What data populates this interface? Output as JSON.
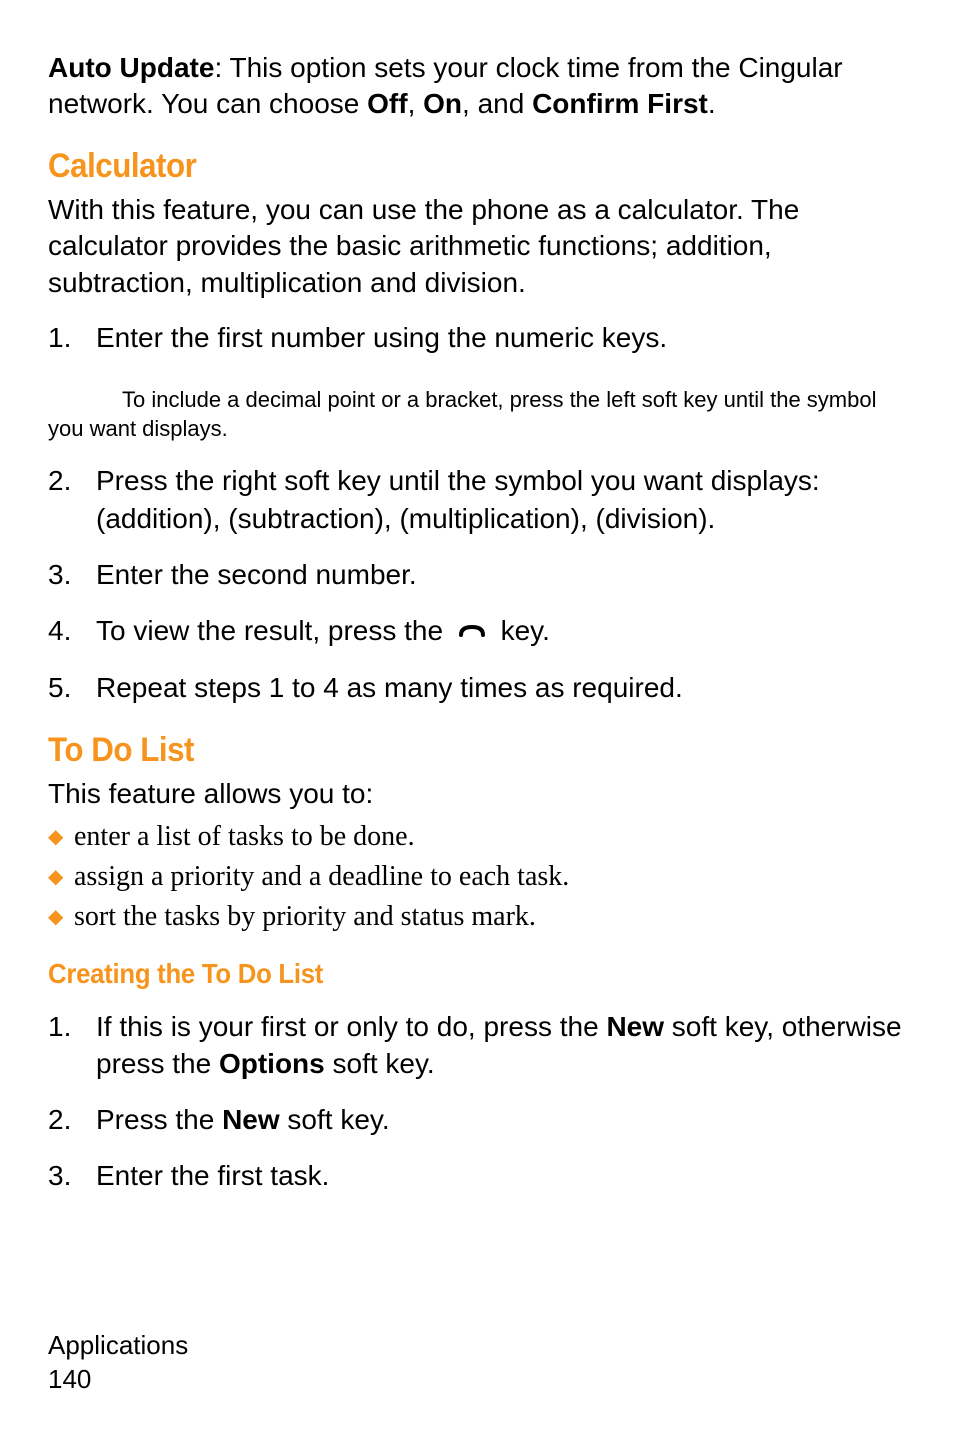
{
  "para1": {
    "strong1": "Auto Update",
    "text1": ": This option sets your clock time from the Cingular network. You can choose ",
    "strong2": "Off",
    "text2": ", ",
    "strong3": "On",
    "text3": ", and ",
    "strong4": "Confirm First",
    "text4": "."
  },
  "calculator": {
    "heading": "Calculator",
    "intro": "With this feature, you can use the phone as a calculator. The calculator provides the basic arithmetic functions; addition, subtraction, multiplication and division.",
    "step1_num": "1.",
    "step1": "Enter the first number using the numeric keys.",
    "note": "To include a decimal point or a bracket, press the left soft key until the symbol you want displays.",
    "step2_num": "2.",
    "step2": "Press the right soft key until the symbol you want displays:  (addition),   (subtraction),   (multiplication),   (division).",
    "step3_num": "3.",
    "step3": "Enter the second number.",
    "step4_num": "4.",
    "step4_a": "To view the result, press the ",
    "step4_b": " key.",
    "step5_num": "5.",
    "step5": "Repeat steps 1 to 4 as many times as required."
  },
  "todo": {
    "heading": "To Do List",
    "intro": "This feature allows you to:",
    "b1": "enter a list of tasks to be done.",
    "b2": "assign a priority and a deadline to each task.",
    "b3": "sort the tasks by priority and status mark.",
    "subheading": "Creating the To Do List",
    "s1_num": "1.",
    "s1_a": "If this is your first or only to do, press the ",
    "s1_new": "New",
    "s1_b": " soft key, otherwise press the ",
    "s1_opt": "Options",
    "s1_c": " soft key.",
    "s2_num": "2.",
    "s2_a": "Press the ",
    "s2_new": "New",
    "s2_b": " soft key.",
    "s3_num": "3.",
    "s3": "Enter the first task."
  },
  "footer": {
    "section": "Applications",
    "page": " 140"
  }
}
